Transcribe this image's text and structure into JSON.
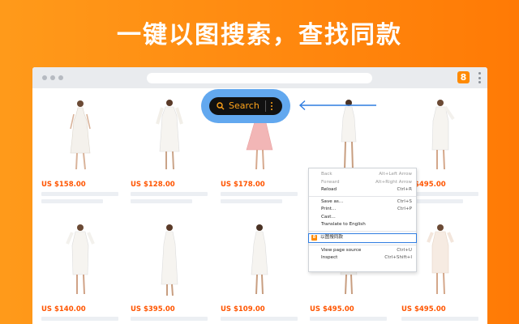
{
  "headline": "一键以图搜索，查找同款",
  "browser": {
    "extension_badge": "8"
  },
  "search_button": {
    "label": "Search"
  },
  "products": [
    {
      "price": "US $158.00"
    },
    {
      "price": "US $128.00"
    },
    {
      "price": "US $178.00"
    },
    {
      "price": ""
    },
    {
      "price": "US $495.00"
    },
    {
      "price": "US $140.00"
    },
    {
      "price": "US $395.00"
    },
    {
      "price": "US $109.00"
    },
    {
      "price": "US $495.00"
    },
    {
      "price": "US $495.00"
    }
  ],
  "context_menu": {
    "items": [
      {
        "label": "Back",
        "shortcut": "Alt+Left Arrow",
        "disabled": true
      },
      {
        "label": "Forward",
        "shortcut": "Alt+Right Arrow",
        "disabled": true
      },
      {
        "label": "Reload",
        "shortcut": "Ctrl+R",
        "disabled": false
      },
      {
        "label": "Save as...",
        "shortcut": "Ctrl+S",
        "disabled": false
      },
      {
        "label": "Print...",
        "shortcut": "Ctrl+P",
        "disabled": false
      },
      {
        "label": "Cast...",
        "shortcut": "",
        "disabled": false
      },
      {
        "label": "Translate to English",
        "shortcut": "",
        "disabled": false
      },
      {
        "label": "以图搜同款",
        "shortcut": "",
        "disabled": false
      },
      {
        "label": "View page source",
        "shortcut": "Ctrl+U",
        "disabled": false
      },
      {
        "label": "Inspect",
        "shortcut": "Ctrl+Shift+I",
        "disabled": false
      }
    ]
  },
  "colors": {
    "background_orange": "#ff8a10",
    "price_orange": "#ff5500",
    "search_highlight_blue": "#62a8ef",
    "menu_highlight_blue": "#2f7de1"
  },
  "icons": [
    "search-icon",
    "extension-icon",
    "kebab-menu-icon",
    "arrow-left-icon",
    "dress-image"
  ]
}
